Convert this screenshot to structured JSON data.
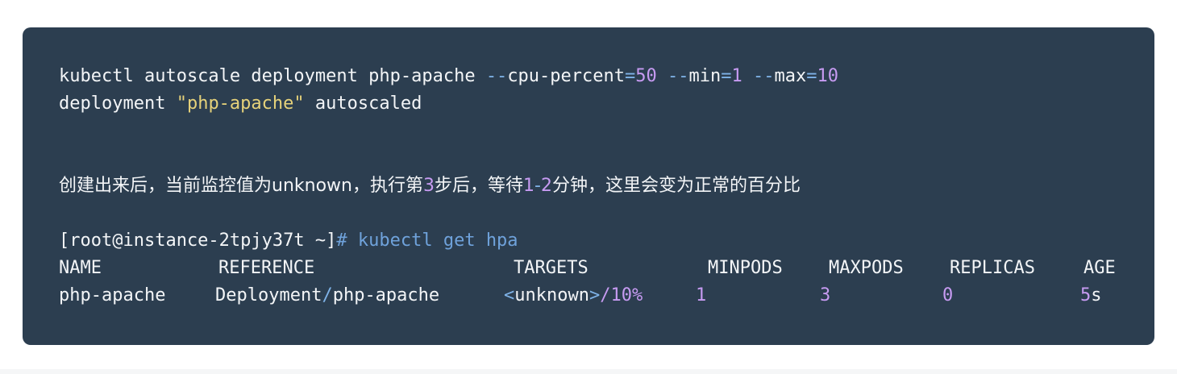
{
  "code": {
    "line1": {
      "cmd": "kubectl autoscale deployment php-apache ",
      "flag_cpu": "--",
      "flag_cpu_name": "cpu-percent",
      "eq1": "=",
      "cpu_value": "50",
      "flag_min": "--",
      "flag_min_name": "min",
      "eq2": "=",
      "min_value": "1",
      "flag_max": "--",
      "flag_max_name": "max",
      "eq3": "=",
      "max_value": "10"
    },
    "line2": {
      "prefix": "deployment ",
      "name": "\"php-apache\"",
      "suffix": " autoscaled"
    },
    "line3": {
      "part1": "创建出来后，当前监控值为unknown，执行第",
      "step": "3",
      "part2": "步后，等待",
      "min1": "1",
      "dash": "-",
      "min2": "2",
      "part3": "分钟，这里会变为正常的百分比"
    },
    "line4": {
      "prompt": "[root@instance-2tpjy37t ~]",
      "hash": "# ",
      "command": "kubectl get hpa"
    },
    "table": {
      "headers": [
        "NAME",
        "REFERENCE",
        "TARGETS",
        "MINPODS",
        "MAXPODS",
        "REPLICAS",
        "AGE"
      ],
      "row": {
        "name": "php-apache",
        "ref_kind": "Deployment",
        "ref_slash": "/",
        "ref_name": "php-apache",
        "targets_lt": "<",
        "targets_value": "unknown",
        "targets_gt": ">",
        "targets_rest": "/10%",
        "minpods": "1",
        "maxpods": "3",
        "replicas": "0",
        "age_num": "5",
        "age_unit": "s"
      }
    }
  },
  "colors": {
    "background": "#2c3e50",
    "text": "#f3f5f7",
    "operator": "#7fb3e8",
    "number": "#c79bf2",
    "string": "#e6d27a"
  }
}
